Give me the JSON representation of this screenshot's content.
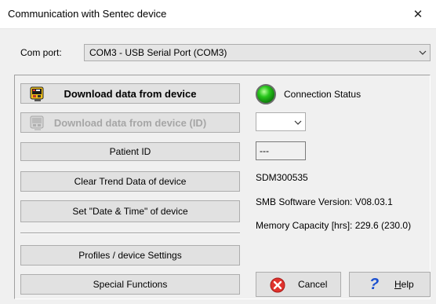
{
  "window": {
    "title": "Communication with Sentec device",
    "close_glyph": "✕"
  },
  "com_port": {
    "label": "Com port:",
    "value": "COM3 - USB Serial Port (COM3)"
  },
  "buttons": {
    "download": "Download data from device",
    "download_id": "Download data from device (ID)",
    "patient_id": "Patient ID",
    "clear_trend": "Clear Trend Data of device",
    "set_datetime": "Set \"Date & Time\" of device",
    "profiles": "Profiles / device Settings",
    "special": "Special Functions"
  },
  "status": {
    "connection_label": "Connection Status",
    "led_color": "#27c61b",
    "id_combo_value": "",
    "patient_id_value": "---",
    "serial": "SDM300535",
    "smb_version": "SMB Software Version: V08.03.1",
    "memory": "Memory Capacity [hrs]: 229.6 (230.0)"
  },
  "dialog": {
    "cancel_label": "Cancel",
    "help_label_hot": "H",
    "help_label_rest": "elp",
    "help_glyph": "?"
  },
  "icons": {
    "download": "download-device-icon",
    "download_id": "download-device-id-icon",
    "cancel": "cancel-icon",
    "help": "help-icon",
    "chevron": "chevron-down-icon"
  }
}
